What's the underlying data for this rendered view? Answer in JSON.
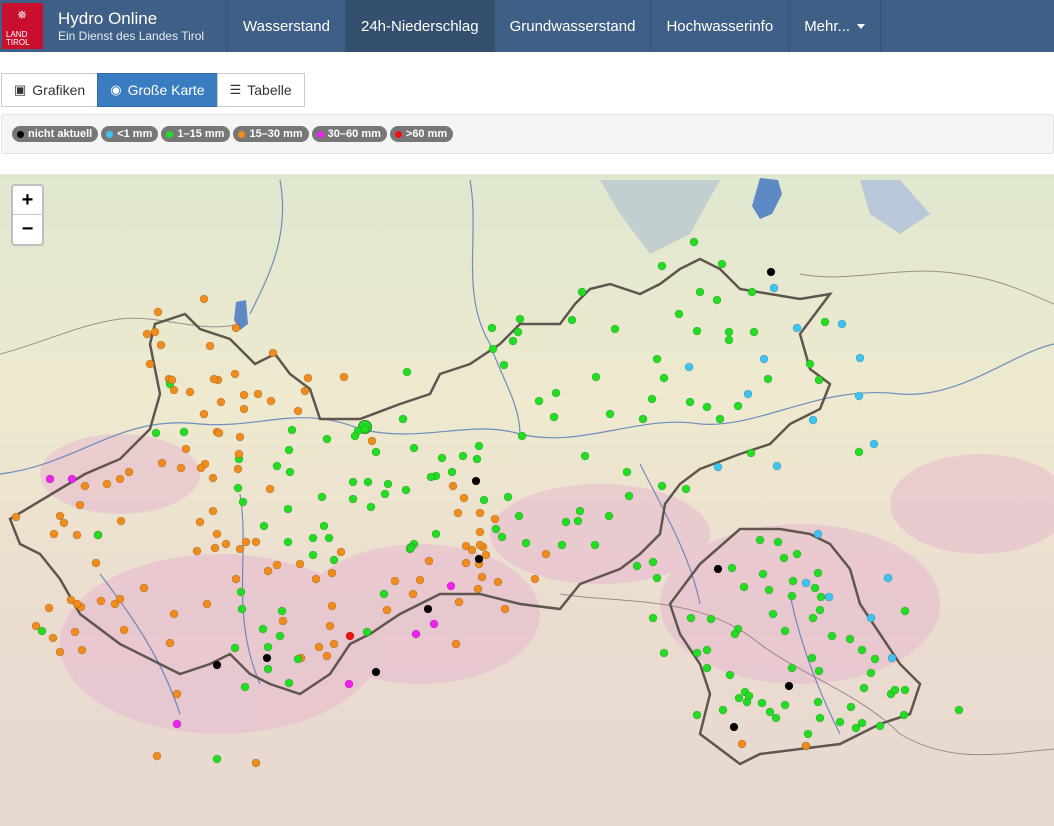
{
  "header": {
    "logo_line1": "LAND",
    "logo_line2": "TIROL",
    "title": "Hydro Online",
    "subtitle": "Ein Dienst des Landes Tirol",
    "nav": [
      {
        "label": "Wasserstand"
      },
      {
        "label": "24h-Niederschlag"
      },
      {
        "label": "Grundwasserstand"
      },
      {
        "label": "Hochwasserinfo"
      },
      {
        "label": "Mehr..."
      }
    ]
  },
  "view_tabs": [
    {
      "label": "Grafiken",
      "icon": "image-icon"
    },
    {
      "label": "Große Karte",
      "icon": "globe-icon",
      "active": true
    },
    {
      "label": "Tabelle",
      "icon": "list-icon"
    }
  ],
  "legend": [
    {
      "label": "nicht aktuell",
      "color": "#000000"
    },
    {
      "label": "<1 mm",
      "color": "#3ec4f0"
    },
    {
      "label": "1–15 mm",
      "color": "#22dd22"
    },
    {
      "label": "15–30 mm",
      "color": "#f08c1c"
    },
    {
      "label": "30–60 mm",
      "color": "#ee22ee"
    },
    {
      "label": ">60 mm",
      "color": "#ee1111"
    }
  ],
  "map": {
    "zoom_in": "+",
    "zoom_out": "−",
    "colors": {
      "na": "#000000",
      "lt1": "#3ec4f0",
      "g": "#22dd22",
      "o": "#f08c1c",
      "m": "#ee22ee",
      "r": "#ee1111"
    }
  }
}
